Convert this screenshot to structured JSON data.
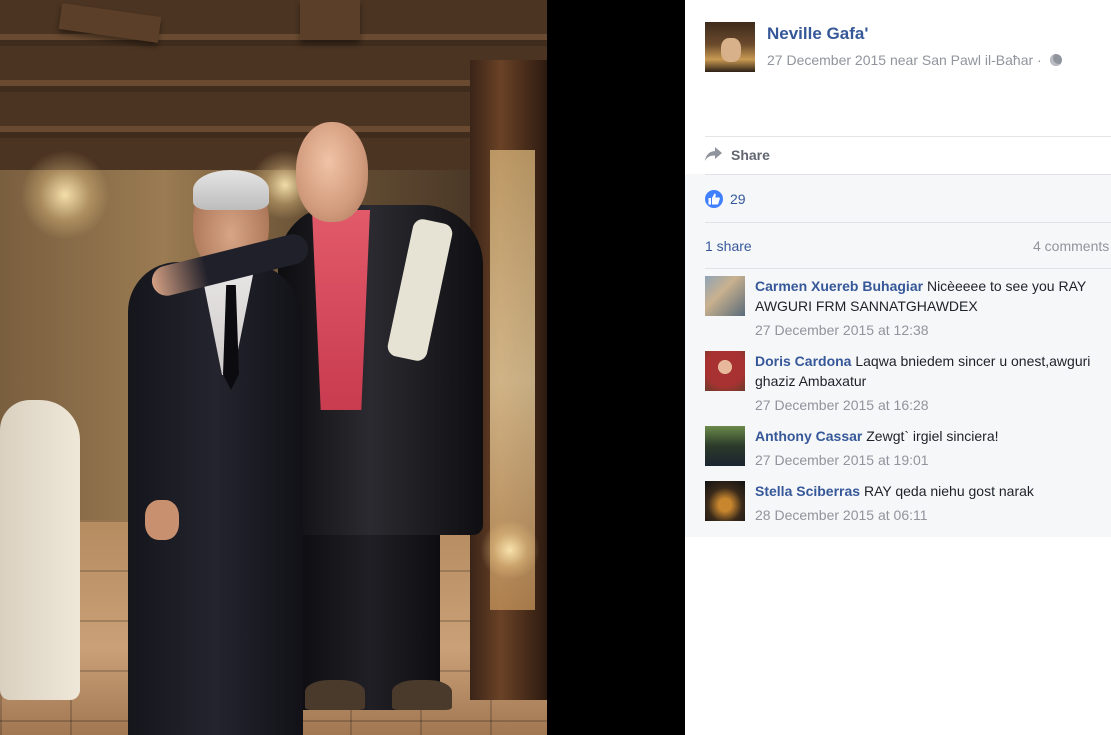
{
  "post": {
    "author": "Neville Gafa'",
    "date_location": "27 December 2015 near San Pawl il-Baħar ·",
    "share_label": "Share",
    "like_count": "29",
    "shares": "1 share",
    "comments_count": "4 comments"
  },
  "comments": [
    {
      "name": "Carmen Xuereb Buhagiar",
      "text": "Nicèeeee to see you RAY AWGURI FRM SANNATGHAWDEX",
      "time": "27 December 2015 at 12:38"
    },
    {
      "name": "Doris Cardona",
      "text": "Laqwa bniedem sincer u onest,awguri ghaziz Ambaxatur",
      "time": "27 December 2015 at 16:28"
    },
    {
      "name": "Anthony Cassar",
      "text": "Zewgt` irgiel sinciera!",
      "time": "27 December 2015 at 19:01"
    },
    {
      "name": "Stella Sciberras",
      "text": "RAY qeda niehu gost narak",
      "time": "28 December 2015 at 06:11"
    }
  ],
  "colors": {
    "link": "#365899",
    "meta": "#90949c",
    "like_blue": "#4080ff",
    "panel_bg": "#ffffff",
    "feedback_bg": "#f6f7f9"
  },
  "icons": [
    "globe-icon",
    "chevron-down-icon",
    "share-arrow-icon",
    "like-thumb-icon"
  ]
}
